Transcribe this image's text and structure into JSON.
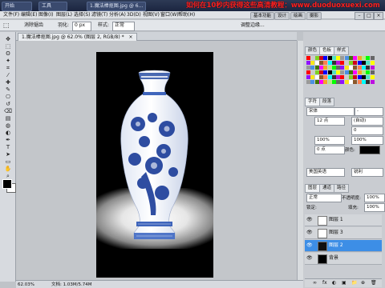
{
  "taskbar": {
    "start": "开始",
    "items": [
      "工具",
      "1.魔法棒抠图.jpg @ 6..."
    ],
    "banner": "如何在10秒内获得这些高清教程：www.duoduoxuexi.com"
  },
  "menubar": {
    "items": [
      "文件(F)",
      "编辑(E)",
      "图像(I)",
      "图层(L)",
      "选择(S)",
      "滤镜(T)",
      "分析(A)",
      "3D(D)",
      "视图(V)",
      "窗口(W)",
      "帮助(H)"
    ],
    "workspaces": [
      "基本功能",
      "设计",
      "绘画",
      "摄影"
    ],
    "window_buttons": [
      "–",
      "□",
      "×"
    ]
  },
  "optbar": {
    "antialias": "消除锯齿",
    "feather_label": "羽化:",
    "feather_value": "0 px",
    "mode_label": "样式:",
    "mode_value": "正常",
    "refine": "调整边缘..."
  },
  "watermark": "优酷",
  "document": {
    "tab_title": "1.魔法棒抠图.jpg @ 62.0% (图层 2, RGB/8) *",
    "close": "×"
  },
  "status": {
    "zoom": "62.03%",
    "doc": "文档: 1.03M/5.74M"
  },
  "tools": {
    "icons": [
      "move-icon",
      "marquee-icon",
      "lasso-icon",
      "magic-wand-icon",
      "crop-icon",
      "eyedropper-icon",
      "healing-icon",
      "brush-icon",
      "stamp-icon",
      "history-brush-icon",
      "eraser-icon",
      "gradient-icon",
      "blur-icon",
      "dodge-icon",
      "pen-icon",
      "type-icon",
      "path-select-icon",
      "shape-icon",
      "hand-icon",
      "zoom-icon"
    ],
    "glyphs": [
      "✥",
      "⬚",
      "ʘ",
      "✦",
      "⌗",
      "⁄",
      "✚",
      "✎",
      "⎔",
      "↺",
      "⌫",
      "▤",
      "◍",
      "◐",
      "✒",
      "T",
      "➤",
      "▭",
      "✋",
      "⌕"
    ],
    "fg_color": "#000000",
    "bg_color": "#ffffff"
  },
  "panels": {
    "top_tabs": [
      "颜色",
      "色板",
      "样式"
    ],
    "swatch_colors": [
      "#ff0000",
      "#ffff00",
      "#00ff00",
      "#00ffff",
      "#0000ff",
      "#ff00ff",
      "#ffffff",
      "#cccccc",
      "#999999",
      "#666666",
      "#333333",
      "#000000",
      "#f5a623",
      "#8b572a",
      "#7ed321",
      "#4a90e2",
      "#9013fe",
      "#bd10e0",
      "#50e3c2",
      "#b8e986",
      "#ff7f50",
      "#d0021b",
      "#417505",
      "#f8e71c"
    ],
    "char_tabs": [
      "字符",
      "段落"
    ],
    "font_family": "宋体",
    "font_style": "-",
    "font_size": "12 点",
    "leading": "(自动)",
    "tracking": "0",
    "scale_v": "100%",
    "scale_h": "100%",
    "baseline": "0 点",
    "color_label": "颜色:",
    "language": "美国英语",
    "aa": "锐利",
    "layer_tabs": [
      "图层",
      "通道",
      "路径"
    ],
    "blend_mode": "正常",
    "opacity_label": "不透明度:",
    "opacity": "100%",
    "lock_label": "锁定:",
    "fill_label": "填充:",
    "fill": "100%",
    "layers": [
      {
        "name": "图层 1",
        "selected": false
      },
      {
        "name": "图层 3",
        "selected": false
      },
      {
        "name": "图层 2",
        "selected": true
      },
      {
        "name": "背景",
        "selected": false
      }
    ],
    "bottom_icons": [
      "∞",
      "fx",
      "◐",
      "▣",
      "📁",
      "⊕",
      "🗑"
    ]
  }
}
